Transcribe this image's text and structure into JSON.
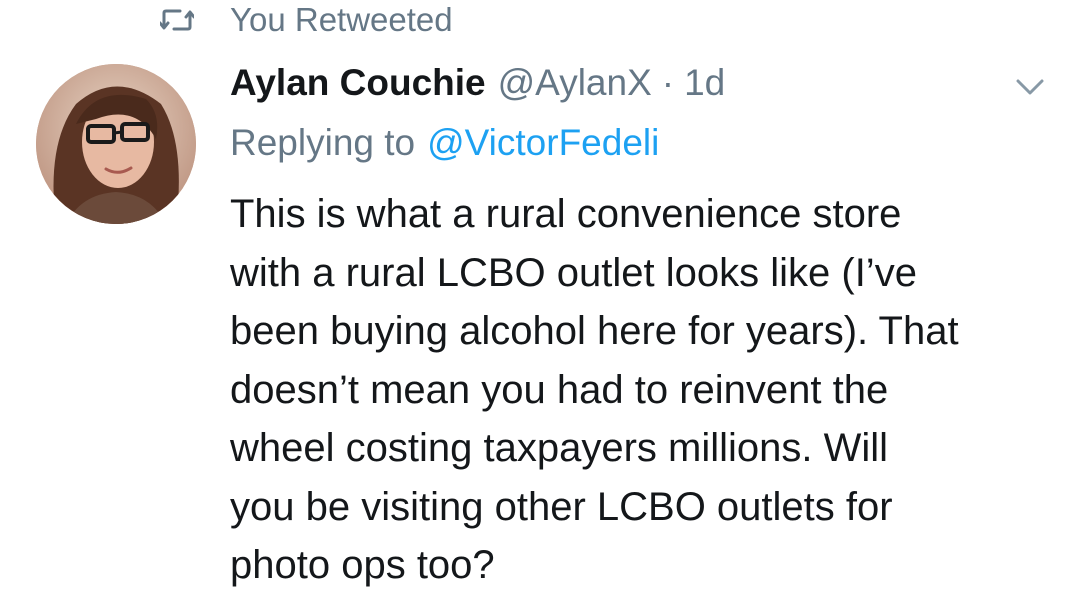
{
  "retweet_header": {
    "icon": "retweet-icon",
    "label": "You Retweeted"
  },
  "tweet": {
    "avatar": "avatar",
    "display_name": "Aylan Couchie",
    "handle": "@AylanX",
    "separator": "·",
    "time": "1d",
    "menu_icon": "chevron-down-icon",
    "reply_prefix": "Replying to",
    "reply_handle": "@VictorFedeli",
    "text_lines": [
      "This is what a rural convenience store",
      "with a rural LCBO outlet looks like (I’ve",
      "been buying alcohol here for years). That",
      "doesn’t mean you had to reinvent the",
      "wheel costing taxpayers millions. Will",
      "you be visiting other LCBO outlets for",
      "photo ops too?"
    ]
  },
  "colors": {
    "text_primary": "#14171a",
    "text_secondary": "#657786",
    "link": "#1da1f2",
    "background": "#ffffff"
  }
}
